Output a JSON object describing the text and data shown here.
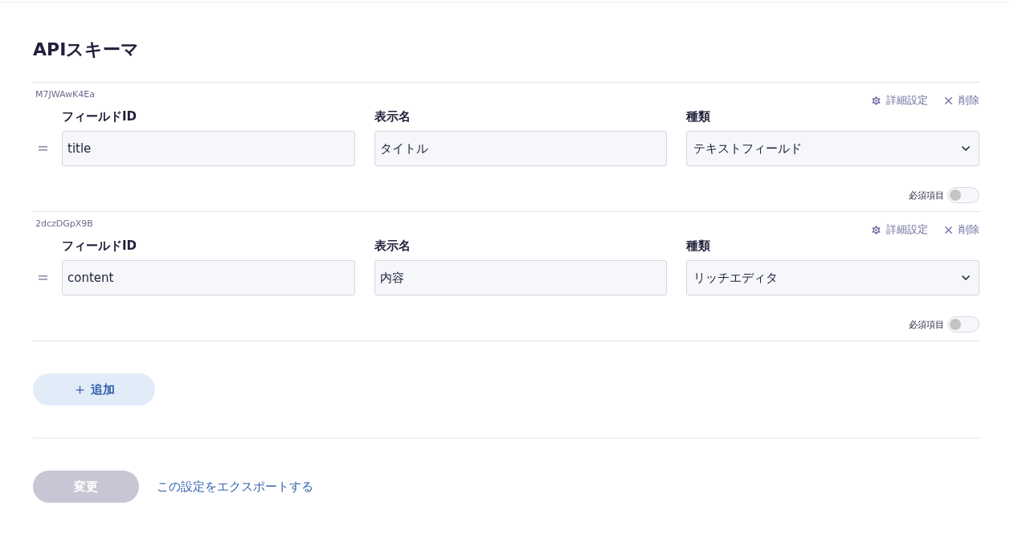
{
  "title": "APIスキーマ",
  "fields": [
    {
      "key": "M7JWAwK4Ea",
      "settings_label": "詳細設定",
      "delete_label": "削除",
      "id_label": "フィールドID",
      "id_value": "title",
      "name_label": "表示名",
      "name_value": "タイトル",
      "type_label": "種類",
      "type_value": "テキストフィールド",
      "required_label": "必須項目",
      "required": false
    },
    {
      "key": "2dczDGpX9B",
      "settings_label": "詳細設定",
      "delete_label": "削除",
      "id_label": "フィールドID",
      "id_value": "content",
      "name_label": "表示名",
      "name_value": "内容",
      "type_label": "種類",
      "type_value": "リッチエディタ",
      "required_label": "必須項目",
      "required": false
    }
  ],
  "add_button": "追加",
  "save_button": {
    "label": "変更",
    "disabled": true
  },
  "export_link": "この設定をエクスポートする"
}
